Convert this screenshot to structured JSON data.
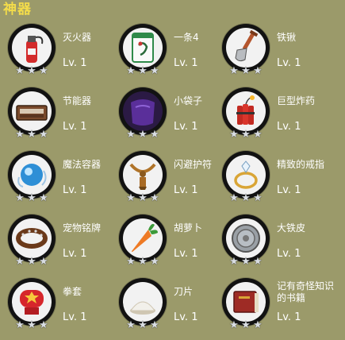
{
  "header": {
    "title": "神器"
  },
  "items": [
    {
      "name": "灭火器",
      "level": "Lv. 1",
      "icon": "fire-extinguisher-icon"
    },
    {
      "name": "一条4",
      "level": "Lv. 1",
      "icon": "mahjong-tile-icon"
    },
    {
      "name": "铁锹",
      "level": "Lv. 1",
      "icon": "shovel-icon"
    },
    {
      "name": "节能器",
      "level": "Lv. 1",
      "icon": "energy-saver-icon"
    },
    {
      "name": "小袋子",
      "level": "Lv. 1",
      "icon": "purple-bag-icon"
    },
    {
      "name": "巨型炸药",
      "level": "Lv. 1",
      "icon": "dynamite-icon"
    },
    {
      "name": "魔法容器",
      "level": "Lv. 1",
      "icon": "magic-orb-icon"
    },
    {
      "name": "闪避护符",
      "level": "Lv. 1",
      "icon": "amulet-necklace-icon"
    },
    {
      "name": "精致的戒指",
      "level": "Lv. 1",
      "icon": "diamond-ring-icon"
    },
    {
      "name": "宠物铭牌",
      "level": "Lv. 1",
      "icon": "pet-collar-icon"
    },
    {
      "name": "胡萝卜",
      "level": "Lv. 1",
      "icon": "carrot-icon"
    },
    {
      "name": "大铁皮",
      "level": "Lv. 1",
      "icon": "iron-shield-icon"
    },
    {
      "name": "拳套",
      "level": "Lv. 1",
      "icon": "boxing-glove-icon"
    },
    {
      "name": "刀片",
      "level": "Lv. 1",
      "icon": "salt-pile-icon"
    },
    {
      "name": "记有奇怪知识的书籍",
      "level": "Lv. 1",
      "icon": "book-icon"
    }
  ],
  "stars_per_item": 3,
  "colors": {
    "background": "#9b9a6a",
    "title": "#f3dc4a",
    "text": "#ffffff",
    "badge_ring": "#121212"
  }
}
